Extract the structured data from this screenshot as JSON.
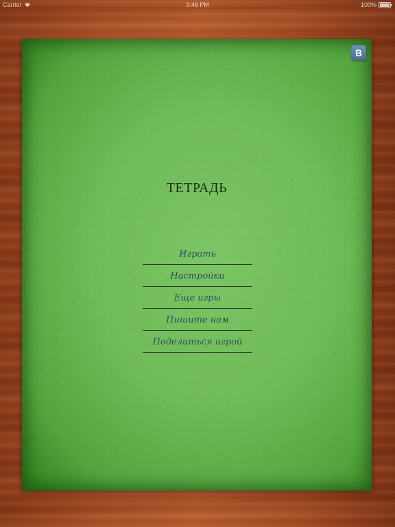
{
  "status_bar": {
    "carrier": "Carrier",
    "time": "3:46 PM",
    "battery": "100%"
  },
  "notebook": {
    "title": "ТЕТРАДЬ",
    "vk_label": "B",
    "menu": [
      {
        "label": "Играть"
      },
      {
        "label": "Настройки"
      },
      {
        "label": "Еще игры"
      },
      {
        "label": "Пишите нам"
      },
      {
        "label": "Поделиться игрой"
      }
    ]
  },
  "colors": {
    "cover_green": "#6fba59",
    "menu_text": "#2f4d5c",
    "vk_blue": "#4b6c95",
    "wood": "#a84e24"
  }
}
